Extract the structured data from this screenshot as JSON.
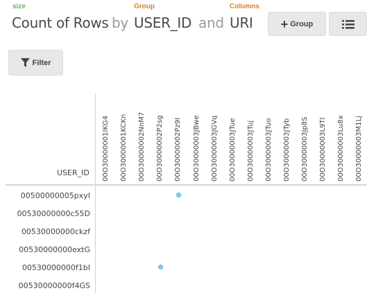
{
  "header": {
    "size_label": "size",
    "group_label": "Group",
    "columns_label": "Columns",
    "metric": "Count of Rows",
    "by": "by",
    "group_field": "USER_ID",
    "and": "and",
    "columns_field": "URI"
  },
  "toolbar": {
    "group_button": "Group",
    "filter_button": "Filter",
    "group_icon": "plus-icon",
    "list_icon": "list-icon",
    "filter_icon": "funnel-icon"
  },
  "grid": {
    "row_axis_title": "USER_ID",
    "columns": [
      "00O30000001IKG4",
      "00O30000001KCKn",
      "00O30000002NnM7",
      "00O30000002P2sg",
      "00O30000002Pz9I",
      "00O30000003JBwe",
      "00O30000003JGVq",
      "00O30000003JTue",
      "00O30000003JTuj",
      "00O30000003JTuo",
      "00O30000003JTyb",
      "00O30000003Jp8S",
      "00O30000003L9TI",
      "00O30000003Lu8x",
      "00O30000003M1Lj"
    ],
    "rows": [
      "00500000005pxyI",
      "00530000000c55D",
      "00530000000ckzf",
      "00530000000extG",
      "00530000000f1bI",
      "00530000000f4GS"
    ],
    "points": [
      {
        "row": 0,
        "col": 4,
        "value": 1
      },
      {
        "row": 4,
        "col": 3,
        "value": 1
      }
    ],
    "colors": {
      "dot_fill": "#7fd0f2",
      "dot_border": "#55b5e0",
      "size_label": "#5cb85c",
      "group_label": "#d9822b"
    }
  }
}
